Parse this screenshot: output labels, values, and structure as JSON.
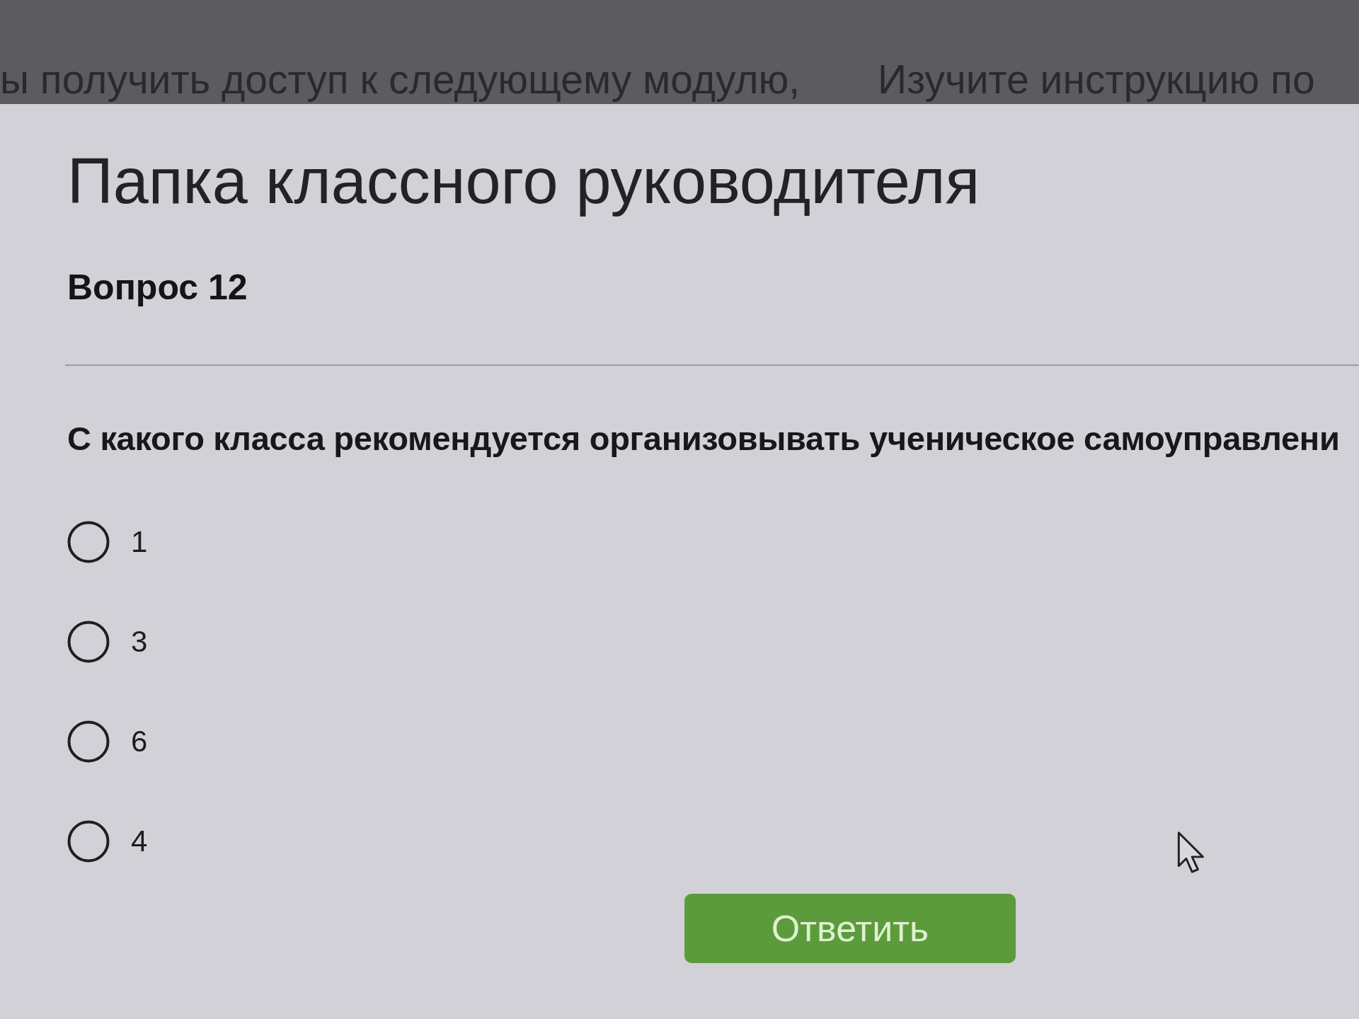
{
  "background_page": {
    "notices": [
      "ы получить доступ к следующему модулю,",
      "Изучите инструкцию по"
    ]
  },
  "dialog": {
    "title": "Папка классного руководителя",
    "question_number": "Вопрос 12",
    "question": "С какого класса рекомендуется организовывать ученическое самоуправлени",
    "options": [
      {
        "label": "1",
        "selected": false
      },
      {
        "label": "3",
        "selected": false
      },
      {
        "label": "6",
        "selected": false
      },
      {
        "label": "4",
        "selected": false
      }
    ],
    "submit_button": "Ответить"
  }
}
